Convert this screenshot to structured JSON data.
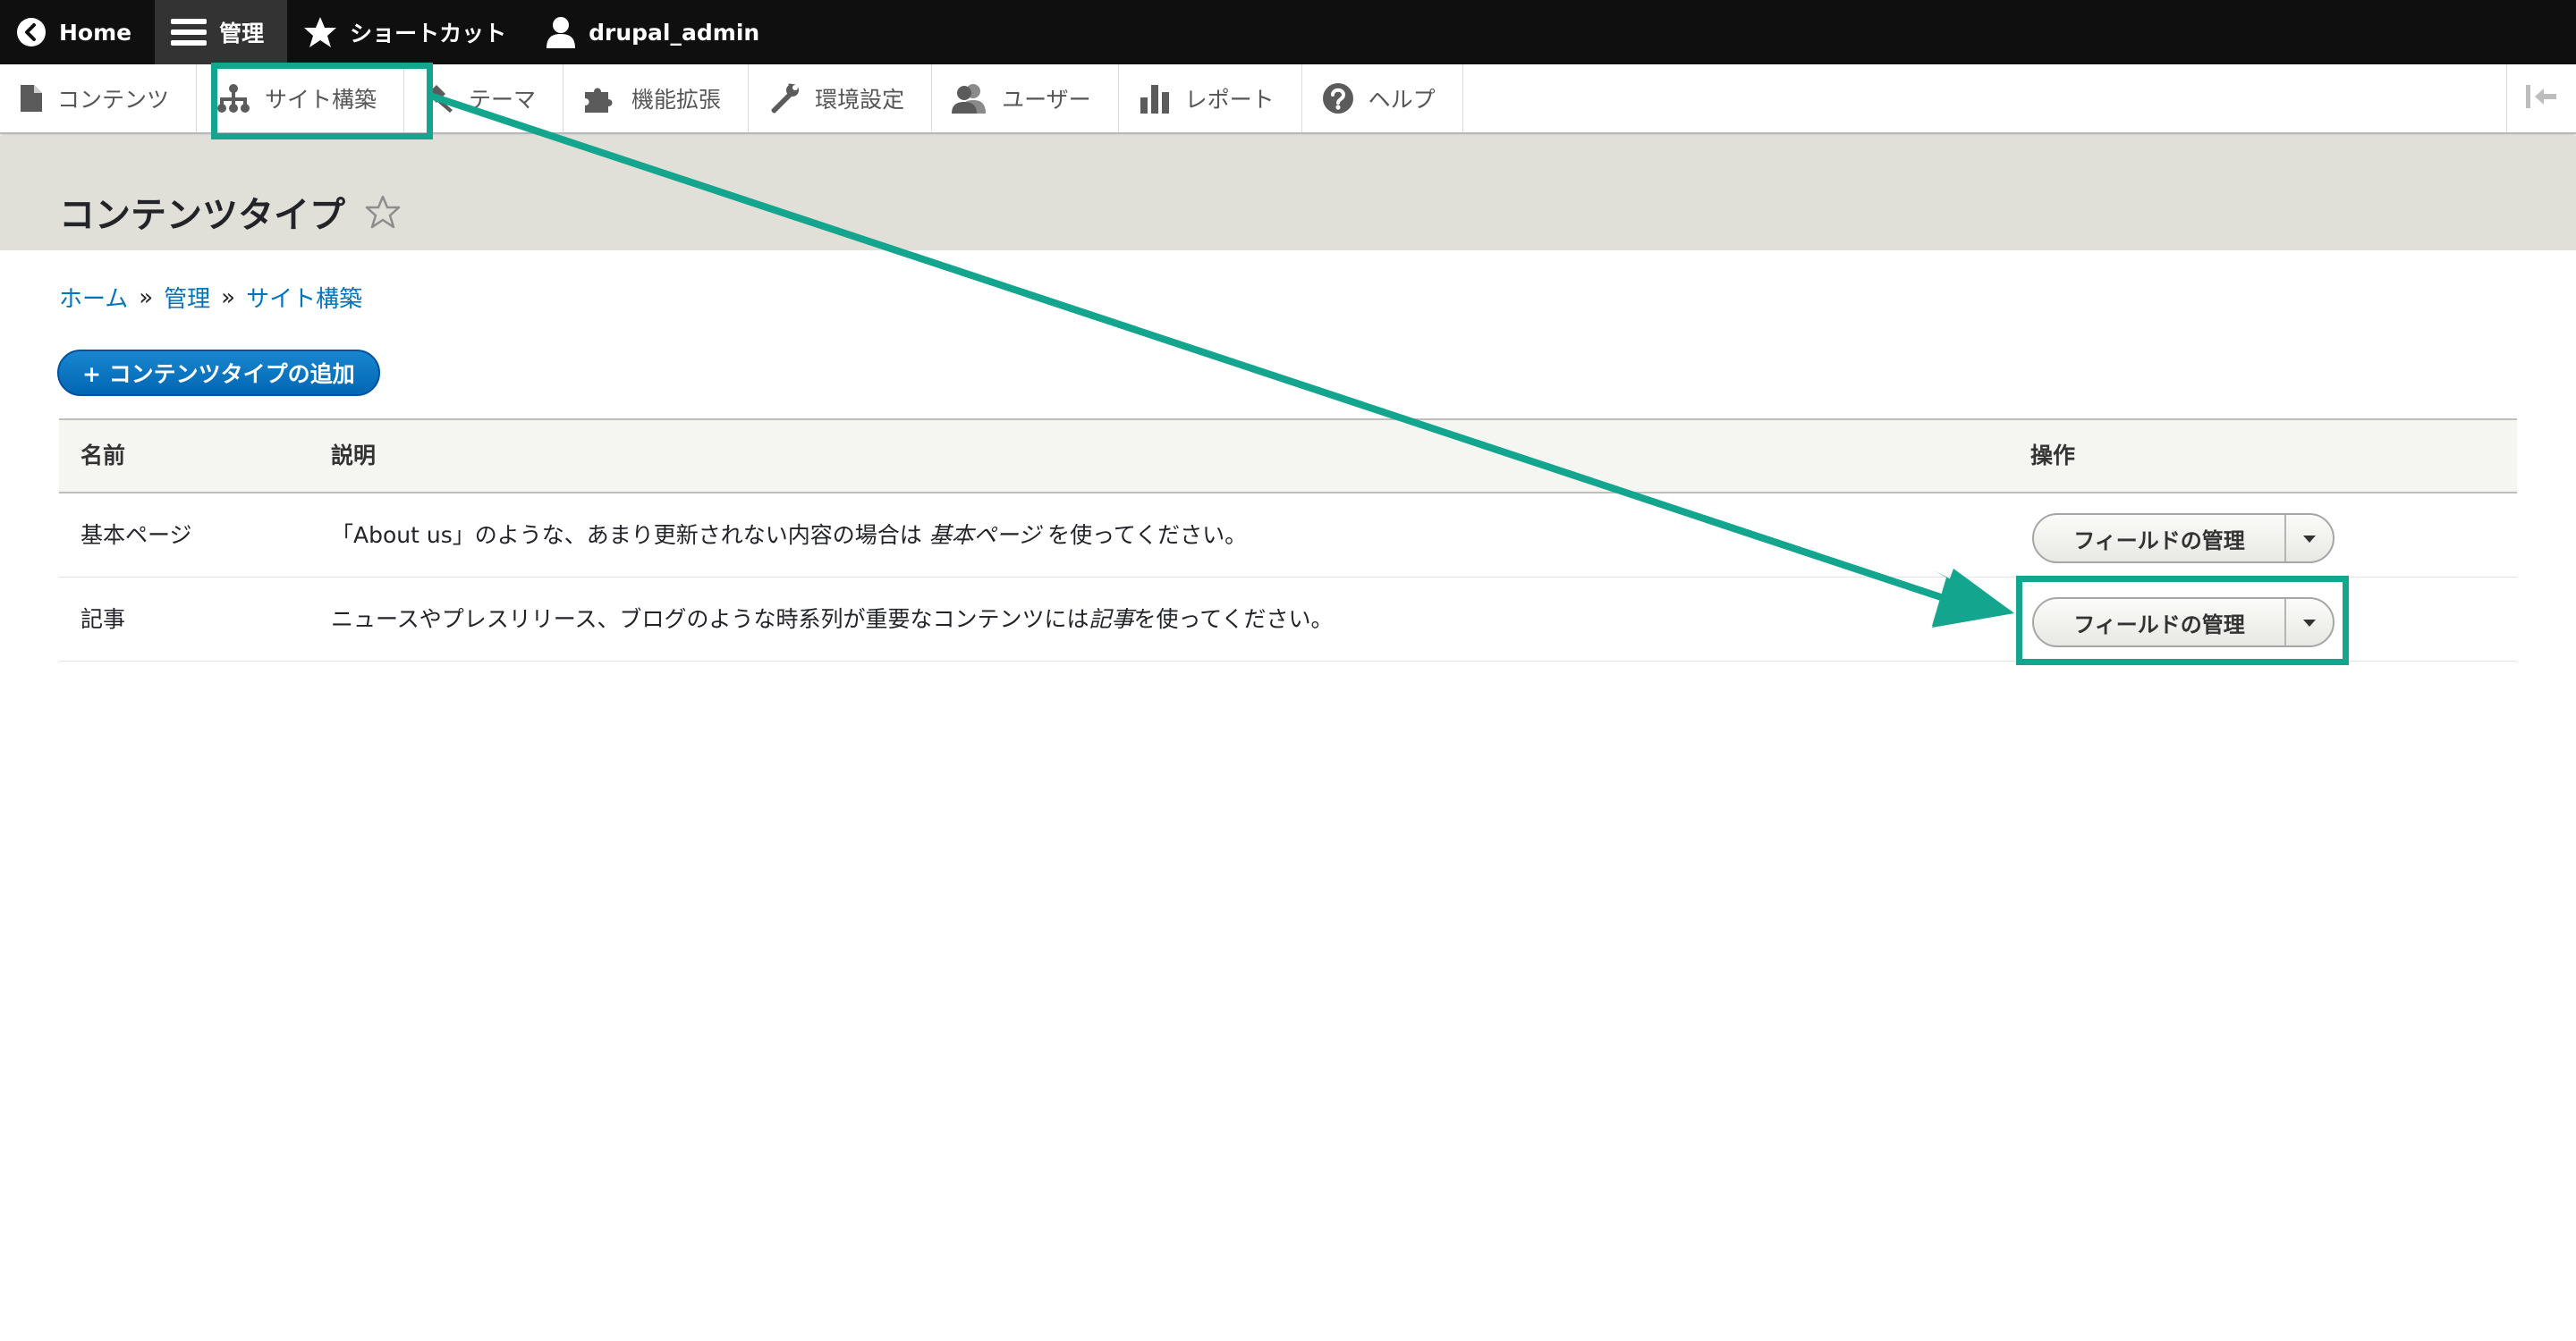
{
  "toolbar": {
    "home_label": "Home",
    "manage_label": "管理",
    "shortcuts_label": "ショートカット",
    "user_label": "drupal_admin"
  },
  "tray": {
    "items": [
      {
        "label": "コンテンツ",
        "icon": "file-icon"
      },
      {
        "label": "サイト構築",
        "icon": "sitemap-icon"
      },
      {
        "label": "テーマ",
        "icon": "paintbrush-icon"
      },
      {
        "label": "機能拡張",
        "icon": "puzzle-icon"
      },
      {
        "label": "環境設定",
        "icon": "wrench-icon"
      },
      {
        "label": "ユーザー",
        "icon": "people-icon"
      },
      {
        "label": "レポート",
        "icon": "bar-chart-icon"
      },
      {
        "label": "ヘルプ",
        "icon": "help-icon"
      }
    ]
  },
  "page": {
    "title": "コンテンツタイプ"
  },
  "breadcrumb": {
    "items": [
      "ホーム",
      "管理",
      "サイト構築"
    ],
    "separator": "»"
  },
  "add_button": {
    "label": "+ コンテンツタイプの追加"
  },
  "table": {
    "headers": {
      "name": "名前",
      "description": "説明",
      "operations": "操作"
    },
    "rows": [
      {
        "name": "基本ページ",
        "description_before": "「About us」のような、あまり更新されない内容の場合は ",
        "description_em": "基本ページ",
        "description_after": " を使ってください。",
        "operation": "フィールドの管理"
      },
      {
        "name": "記事",
        "description_before": "ニュースやプレスリリース、ブログのような時系列が重要なコンテンツには",
        "description_em": "記事",
        "description_after": "を使ってください。",
        "operation": "フィールドの管理"
      }
    ]
  },
  "colors": {
    "toolbar_bg": "#0f0f0f",
    "link": "#0074bd",
    "primary_button": "#0071b8",
    "annotation": "#14a58e",
    "header_bg": "#e0e0d8"
  }
}
